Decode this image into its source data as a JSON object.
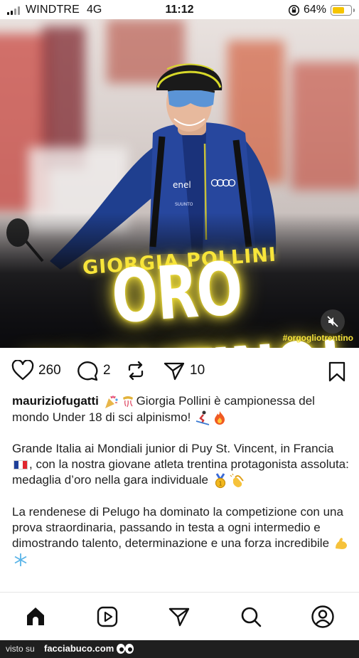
{
  "status_bar": {
    "carrier": "WINDTRE",
    "network": "4G",
    "time": "11:12",
    "battery_percent": "64%",
    "battery_level": 0.64,
    "icons": [
      "signal-icon",
      "orientation-lock-icon",
      "battery-icon"
    ]
  },
  "post": {
    "image": {
      "name_text": "GIORGIA POLLINI",
      "headline": "ORO TRENTINO!",
      "hashtag": "#orgogliotrentino",
      "accent_color": "#f8e53b",
      "icons": [
        "mute-icon"
      ]
    },
    "actions": {
      "likes": "260",
      "comments": "2",
      "shares": "10",
      "icons": [
        "heart-icon",
        "comment-icon",
        "repost-icon",
        "send-icon",
        "bookmark-icon"
      ]
    },
    "caption": {
      "author": "mauriziofugatti",
      "paragraph1_text": "Giorgia Pollini è campionessa del mondo Under 18 di sci alpinismo!",
      "paragraph2_part1": "Grande Italia ai Mondiali junior di Puy St. Vincent, in Francia",
      "paragraph2_part2": ", con la nostra giovane atleta trentina protagonista assoluta: medaglia d’oro nella gara individuale",
      "paragraph3_text": "La rendenese di Pelugo ha dominato la competizione con una prova straordinaria, passando in testa a ogni intermedio e dimostrando talento, determinazione e una forza incredibile",
      "emoji_names": [
        "party-popper-icon",
        "confetti-icon",
        "skier-icon",
        "fire-icon",
        "france-flag-icon",
        "gold-medal-icon",
        "clapping-hands-icon",
        "flexed-biceps-icon",
        "snowflake-icon"
      ]
    }
  },
  "bottom_nav": {
    "items": [
      "home-icon",
      "reels-icon",
      "send-icon",
      "search-icon",
      "profile-icon"
    ]
  },
  "watermark": {
    "prefix": "visto su",
    "site": "facciabuco.com"
  }
}
